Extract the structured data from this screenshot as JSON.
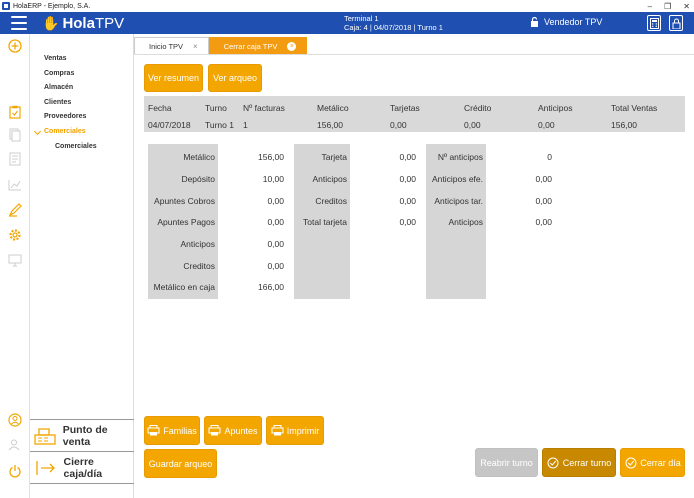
{
  "window": {
    "title": "HolaERP - Ejemplo, S.A."
  },
  "header": {
    "logo_prefix": "Hola",
    "logo_suffix": "TPV",
    "terminal_line1": "Terminal 1",
    "terminal_line2": "Caja: 4 | 04/07/2018 | Turno 1",
    "vendor": "Vendedor TPV"
  },
  "sidebar": {
    "menu": [
      {
        "label": "Ventas"
      },
      {
        "label": "Compras"
      },
      {
        "label": "Almacén"
      },
      {
        "label": "Clientes"
      },
      {
        "label": "Proveedores"
      },
      {
        "label": "Comerciales"
      },
      {
        "label": "Comerciales"
      }
    ],
    "punto_venta": "Punto de venta",
    "cierre_caja": "Cierre caja/día"
  },
  "tabs": [
    {
      "label": "Inicio TPV"
    },
    {
      "label": "Cerrar caja TPV"
    }
  ],
  "top_buttons": {
    "resumen": "Ver resumen",
    "arqueo": "Ver arqueo"
  },
  "summary": {
    "headers": [
      "Fecha",
      "Turno",
      "Nº facturas",
      "Metálico",
      "Tarjetas",
      "Crédito",
      "Anticipos",
      "Total Ventas"
    ],
    "values": [
      "04/07/2018",
      "Turno 1",
      "1",
      "156,00",
      "0,00",
      "0,00",
      "0,00",
      "156,00"
    ]
  },
  "block1": [
    {
      "label": "Metálico",
      "value": "156,00"
    },
    {
      "label": "Depósito",
      "value": "10,00"
    },
    {
      "label": "Apuntes Cobros",
      "value": "0,00"
    },
    {
      "label": "Apuntes Pagos",
      "value": "0,00"
    },
    {
      "label": "Anticipos",
      "value": "0,00"
    },
    {
      "label": "Creditos",
      "value": "0,00"
    },
    {
      "label": "Metálico en caja",
      "value": "166,00"
    }
  ],
  "block2": [
    {
      "label": "Tarjeta",
      "value": "0,00"
    },
    {
      "label": "Anticipos",
      "value": "0,00"
    },
    {
      "label": "Creditos",
      "value": "0,00"
    },
    {
      "label": "Total tarjeta",
      "value": "0,00"
    }
  ],
  "block3": [
    {
      "label": "Nº anticipos",
      "value": "0"
    },
    {
      "label": "Anticipos efe.",
      "value": "0,00"
    },
    {
      "label": "Anticipos tar.",
      "value": "0,00"
    },
    {
      "label": "Anticipos",
      "value": "0,00"
    }
  ],
  "bottom_buttons": {
    "familias": "Familias",
    "apuntes": "Apuntes",
    "imprimir": "Imprimir",
    "guardar": "Guardar arqueo",
    "reabrir": "Reabrir turno",
    "cerrar_turno": "Cerrar turno",
    "cerrar_dia": "Cerrar día"
  },
  "colors": {
    "header_blue": "#1f4fb0",
    "accent_orange": "#f3a600",
    "active_menu": "#f3a100"
  }
}
